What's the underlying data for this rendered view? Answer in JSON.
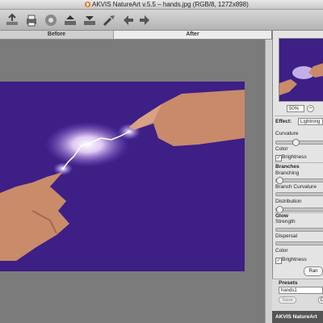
{
  "window": {
    "title": "AKVIS NatureArt v.5.5 – hands.jpg (RGB/8, 1272x898)"
  },
  "toolbar": {
    "icons": [
      "open-icon",
      "print-icon",
      "save-icon",
      "upload-icon",
      "download-icon",
      "brush-icon",
      "back-icon",
      "forward-icon"
    ]
  },
  "tabs": {
    "before": "Before",
    "after": "After"
  },
  "panel": {
    "zoom_value": "50%",
    "zoom_minus": "−",
    "effect_label": "Effect:",
    "effect_value": "Lightning",
    "curvature": "Curvature",
    "color1": "Color",
    "brightness1": "Brightness",
    "branches_header": "Branches",
    "branching": "Branching",
    "branch_curvature": "Branch Curvature",
    "distribution": "Distribution",
    "glow_header": "Glow",
    "strength": "Strength",
    "dispersal": "Dispersal",
    "color2": "Color",
    "brightness2": "Brightness",
    "random_label": "Ran",
    "presets_header": "Presets",
    "preset_value": "hands1",
    "save_label": "Save",
    "delete_label": "D",
    "logo_text": "AKVIS NatureArt"
  },
  "colors": {
    "photo_background": "#3d1f86",
    "lightning_glow": "#e9d6ff"
  }
}
